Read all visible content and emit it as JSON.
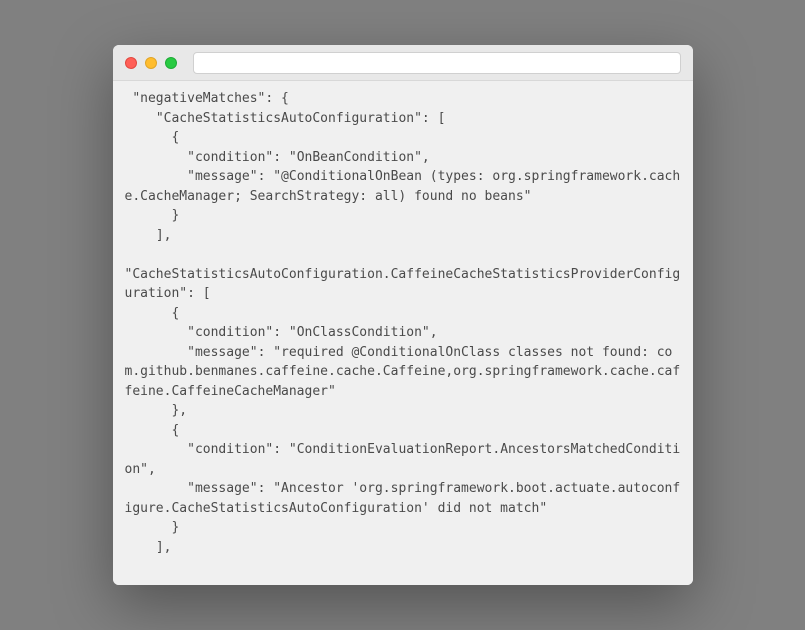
{
  "window": {
    "addressbar_value": ""
  },
  "code": {
    "text": " \"negativeMatches\": {\n    \"CacheStatisticsAutoConfiguration\": [\n      {\n        \"condition\": \"OnBeanCondition\",\n        \"message\": \"@ConditionalOnBean (types: org.springframework.cache.CacheManager; SearchStrategy: all) found no beans\"\n      }\n    ],\n    \n\"CacheStatisticsAutoConfiguration.CaffeineCacheStatisticsProviderConfiguration\": [\n      {\n        \"condition\": \"OnClassCondition\",\n        \"message\": \"required @ConditionalOnClass classes not found: com.github.benmanes.caffeine.cache.Caffeine,org.springframework.cache.caffeine.CaffeineCacheManager\"\n      },\n      {\n        \"condition\": \"ConditionEvaluationReport.AncestorsMatchedCondition\",\n        \"message\": \"Ancestor 'org.springframework.boot.actuate.autoconfigure.CacheStatisticsAutoConfiguration' did not match\"\n      }\n    ],"
  }
}
